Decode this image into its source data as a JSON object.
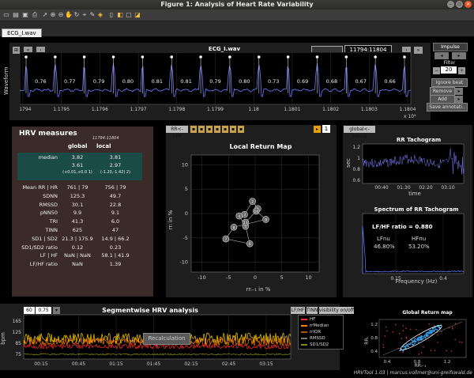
{
  "window": {
    "title": "Figure 1: Analysis of Heart Rate Variability"
  },
  "tab": {
    "label": "ECG_I.wav"
  },
  "ecg": {
    "title": "ECG_I.wav",
    "range": "11794:11804",
    "ylabel": "Waveform",
    "x_multiplier": "x 10⁴",
    "xticks": [
      "1.1794",
      "1.1795",
      "1.1796",
      "1.1797",
      "1.1798",
      "1.1799",
      "1.18",
      "1.1801",
      "1.1802",
      "1.1803",
      "1.1804"
    ],
    "rr_labels": [
      "0.76",
      "0.77",
      "0.79",
      "0.80",
      "0.81",
      "0.81",
      "0.79",
      "0.80",
      "0.73",
      "0.69",
      "0.68",
      "0.67",
      "0.66"
    ]
  },
  "right_controls": {
    "impulse": "Impulse",
    "filter_label": "Filter",
    "filter_value": "20",
    "ignore_beat": "Ignore beat",
    "remove": "Remove",
    "add": "Add",
    "save": "Save annotati.."
  },
  "hrv": {
    "title": "HRV measures",
    "range_small": "11794:11804",
    "col_global": "global",
    "col_local": "local",
    "rows": [
      {
        "label": "median",
        "global": "3.82",
        "local": "3.81"
      },
      {
        "label": "",
        "global": "3.61",
        "local": "2.97"
      },
      {
        "label": "",
        "global": "(+0.01,+0.0 1)",
        "local": "(-1.20,-1.42) 2)"
      },
      {
        "label": "Mean RR | HR",
        "global": "761 | 79",
        "local": "756 | 79"
      },
      {
        "label": "SDNN",
        "global": "125.3",
        "local": "49.7"
      },
      {
        "label": "RMSSD",
        "global": "30.1",
        "local": "22.8"
      },
      {
        "label": "pNN50",
        "global": "9.9",
        "local": "9.1"
      },
      {
        "label": "TRI",
        "global": "41.3",
        "local": "6.0"
      },
      {
        "label": "TINN",
        "global": "625",
        "local": "47"
      },
      {
        "label": "SD1 | SD2",
        "global": "21.3 | 175.9",
        "local": "14.9 | 66.2"
      },
      {
        "label": "SD1/SD2 ratio",
        "global": "0.12",
        "local": "0.23"
      },
      {
        "label": "LF | HF",
        "global": "NaN | NaN",
        "local": "58.1 | 41.9"
      },
      {
        "label": "LF/HF ratio",
        "global": "NaN",
        "local": "1.39"
      }
    ]
  },
  "return_map": {
    "title": "Local Return Map",
    "toolbar_label": "RR<->HF",
    "badge": "1",
    "ylabel": "rrᵢ in %",
    "xlabel": "rrᵢ₋₁ in %",
    "xticks": [
      "-10",
      "-5",
      "0",
      "5",
      "10"
    ],
    "yticks": [
      "10",
      "5",
      "0",
      "-5",
      "-10"
    ],
    "points": [
      {
        "n": "1",
        "x": 0.5,
        "y": 1.0
      },
      {
        "n": "2",
        "x": -0.5,
        "y": 2.5
      },
      {
        "n": "3",
        "x": -2.0,
        "y": -0.2
      },
      {
        "n": "4",
        "x": -3.0,
        "y": -0.5
      },
      {
        "n": "5",
        "x": -1.8,
        "y": -2.6
      },
      {
        "n": "6",
        "x": -1.0,
        "y": -6.2
      },
      {
        "n": "7",
        "x": -5.5,
        "y": -5.2
      },
      {
        "n": "8",
        "x": -4.0,
        "y": -2.8
      },
      {
        "n": "9",
        "x": 2.0,
        "y": -1.2
      },
      {
        "n": "10",
        "x": 0.2,
        "y": 0.5
      },
      {
        "n": "11",
        "x": -1.8,
        "y": -1.8
      }
    ]
  },
  "tacho": {
    "toggle": "global<->local",
    "title": "RR Tachogram",
    "ylabel": "sec",
    "xlabel": "time",
    "yticks": [
      "1.2",
      "1",
      "0.8",
      "0.6"
    ],
    "xticks": [
      "00:40",
      "01:30",
      "02:20",
      "03:10"
    ]
  },
  "spectrum": {
    "title": "Spectrum of RR Tachogram",
    "ratio": "LF/HF ratio = 0.880",
    "lf_label": "LFnu",
    "lf_value": "46.80%",
    "hf_label": "HFnu",
    "hf_value": "53.20%",
    "xlabel": "Frequency (Hz)",
    "xticks": [
      "0.15",
      "0.4"
    ]
  },
  "segment": {
    "window_value": "60",
    "step_value": "0.75",
    "title": "Segmentwise HRV analysis",
    "btn_lfhf": "LF/HF",
    "btn_tinn": "TINN",
    "btn_vis": "visibility on/off",
    "recalc": "Recalculation",
    "ylabel": "bpm",
    "yticks": [
      "165",
      "125",
      "85",
      "75"
    ],
    "xticks": [
      "00:15",
      "00:45",
      "01:15",
      "01:45",
      "02:15",
      "02:45",
      "03:15"
    ],
    "legend": [
      {
        "label": "HF",
        "color": "#ff2a2a"
      },
      {
        "label": "rrMedian",
        "color": "#ff7f00"
      },
      {
        "label": "rrIQR",
        "color": "#aa5500"
      },
      {
        "label": "RMSSD",
        "color": "#777777"
      },
      {
        "label": "SD1/SD2",
        "color": "#888800"
      }
    ]
  },
  "global_map": {
    "title": "Global Return map",
    "ylabel": "RRᵢ",
    "xlabel": "RRᵢ₋₁",
    "xticks": [
      "0.4",
      "0.8",
      "1.2"
    ],
    "yticks": [
      "1.2",
      "0.8",
      "0.4"
    ]
  },
  "footer": {
    "credit": "HRVTool 1.03 | marcus.vollmer@uni-greifswald.de"
  }
}
